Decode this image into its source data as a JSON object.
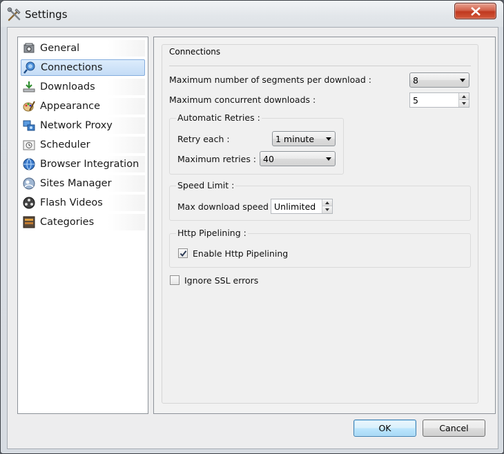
{
  "window": {
    "title": "Settings"
  },
  "sidebar": {
    "items": [
      {
        "label": "General",
        "icon": "general-icon"
      },
      {
        "label": "Connections",
        "icon": "connections-icon",
        "selected": true
      },
      {
        "label": "Downloads",
        "icon": "downloads-icon"
      },
      {
        "label": "Appearance",
        "icon": "appearance-icon"
      },
      {
        "label": "Network Proxy",
        "icon": "network-proxy-icon"
      },
      {
        "label": "Scheduler",
        "icon": "scheduler-icon"
      },
      {
        "label": "Browser Integration",
        "icon": "browser-integration-icon"
      },
      {
        "label": "Sites Manager",
        "icon": "sites-manager-icon"
      },
      {
        "label": "Flash Videos",
        "icon": "flash-videos-icon"
      },
      {
        "label": "Categories",
        "icon": "categories-icon"
      }
    ]
  },
  "connections": {
    "group_title": "Connections",
    "max_segments_label": "Maximum number of segments per download :",
    "max_segments_value": "8",
    "max_concurrent_label": "Maximum concurrent downloads :",
    "max_concurrent_value": "5",
    "auto_retries": {
      "title": "Automatic Retries :",
      "retry_each_label": "Retry each :",
      "retry_each_value": "1 minute",
      "max_retries_label": "Maximum retries :",
      "max_retries_value": "40"
    },
    "speed_limit": {
      "title": "Speed Limit :",
      "max_speed_label": "Max download speed :",
      "max_speed_value": "Unlimited"
    },
    "http_pipelining": {
      "title": "Http Pipelining :",
      "enable_label": "Enable Http Pipelining",
      "enabled": true
    },
    "ignore_ssl_label": "Ignore SSL errors",
    "ignore_ssl_checked": false
  },
  "buttons": {
    "ok": "OK",
    "cancel": "Cancel"
  },
  "colors": {
    "selection": "#c4dcf6",
    "selection_border": "#84acdd",
    "close_button": "#c0391f",
    "default_button_border": "#3c7fb1"
  }
}
